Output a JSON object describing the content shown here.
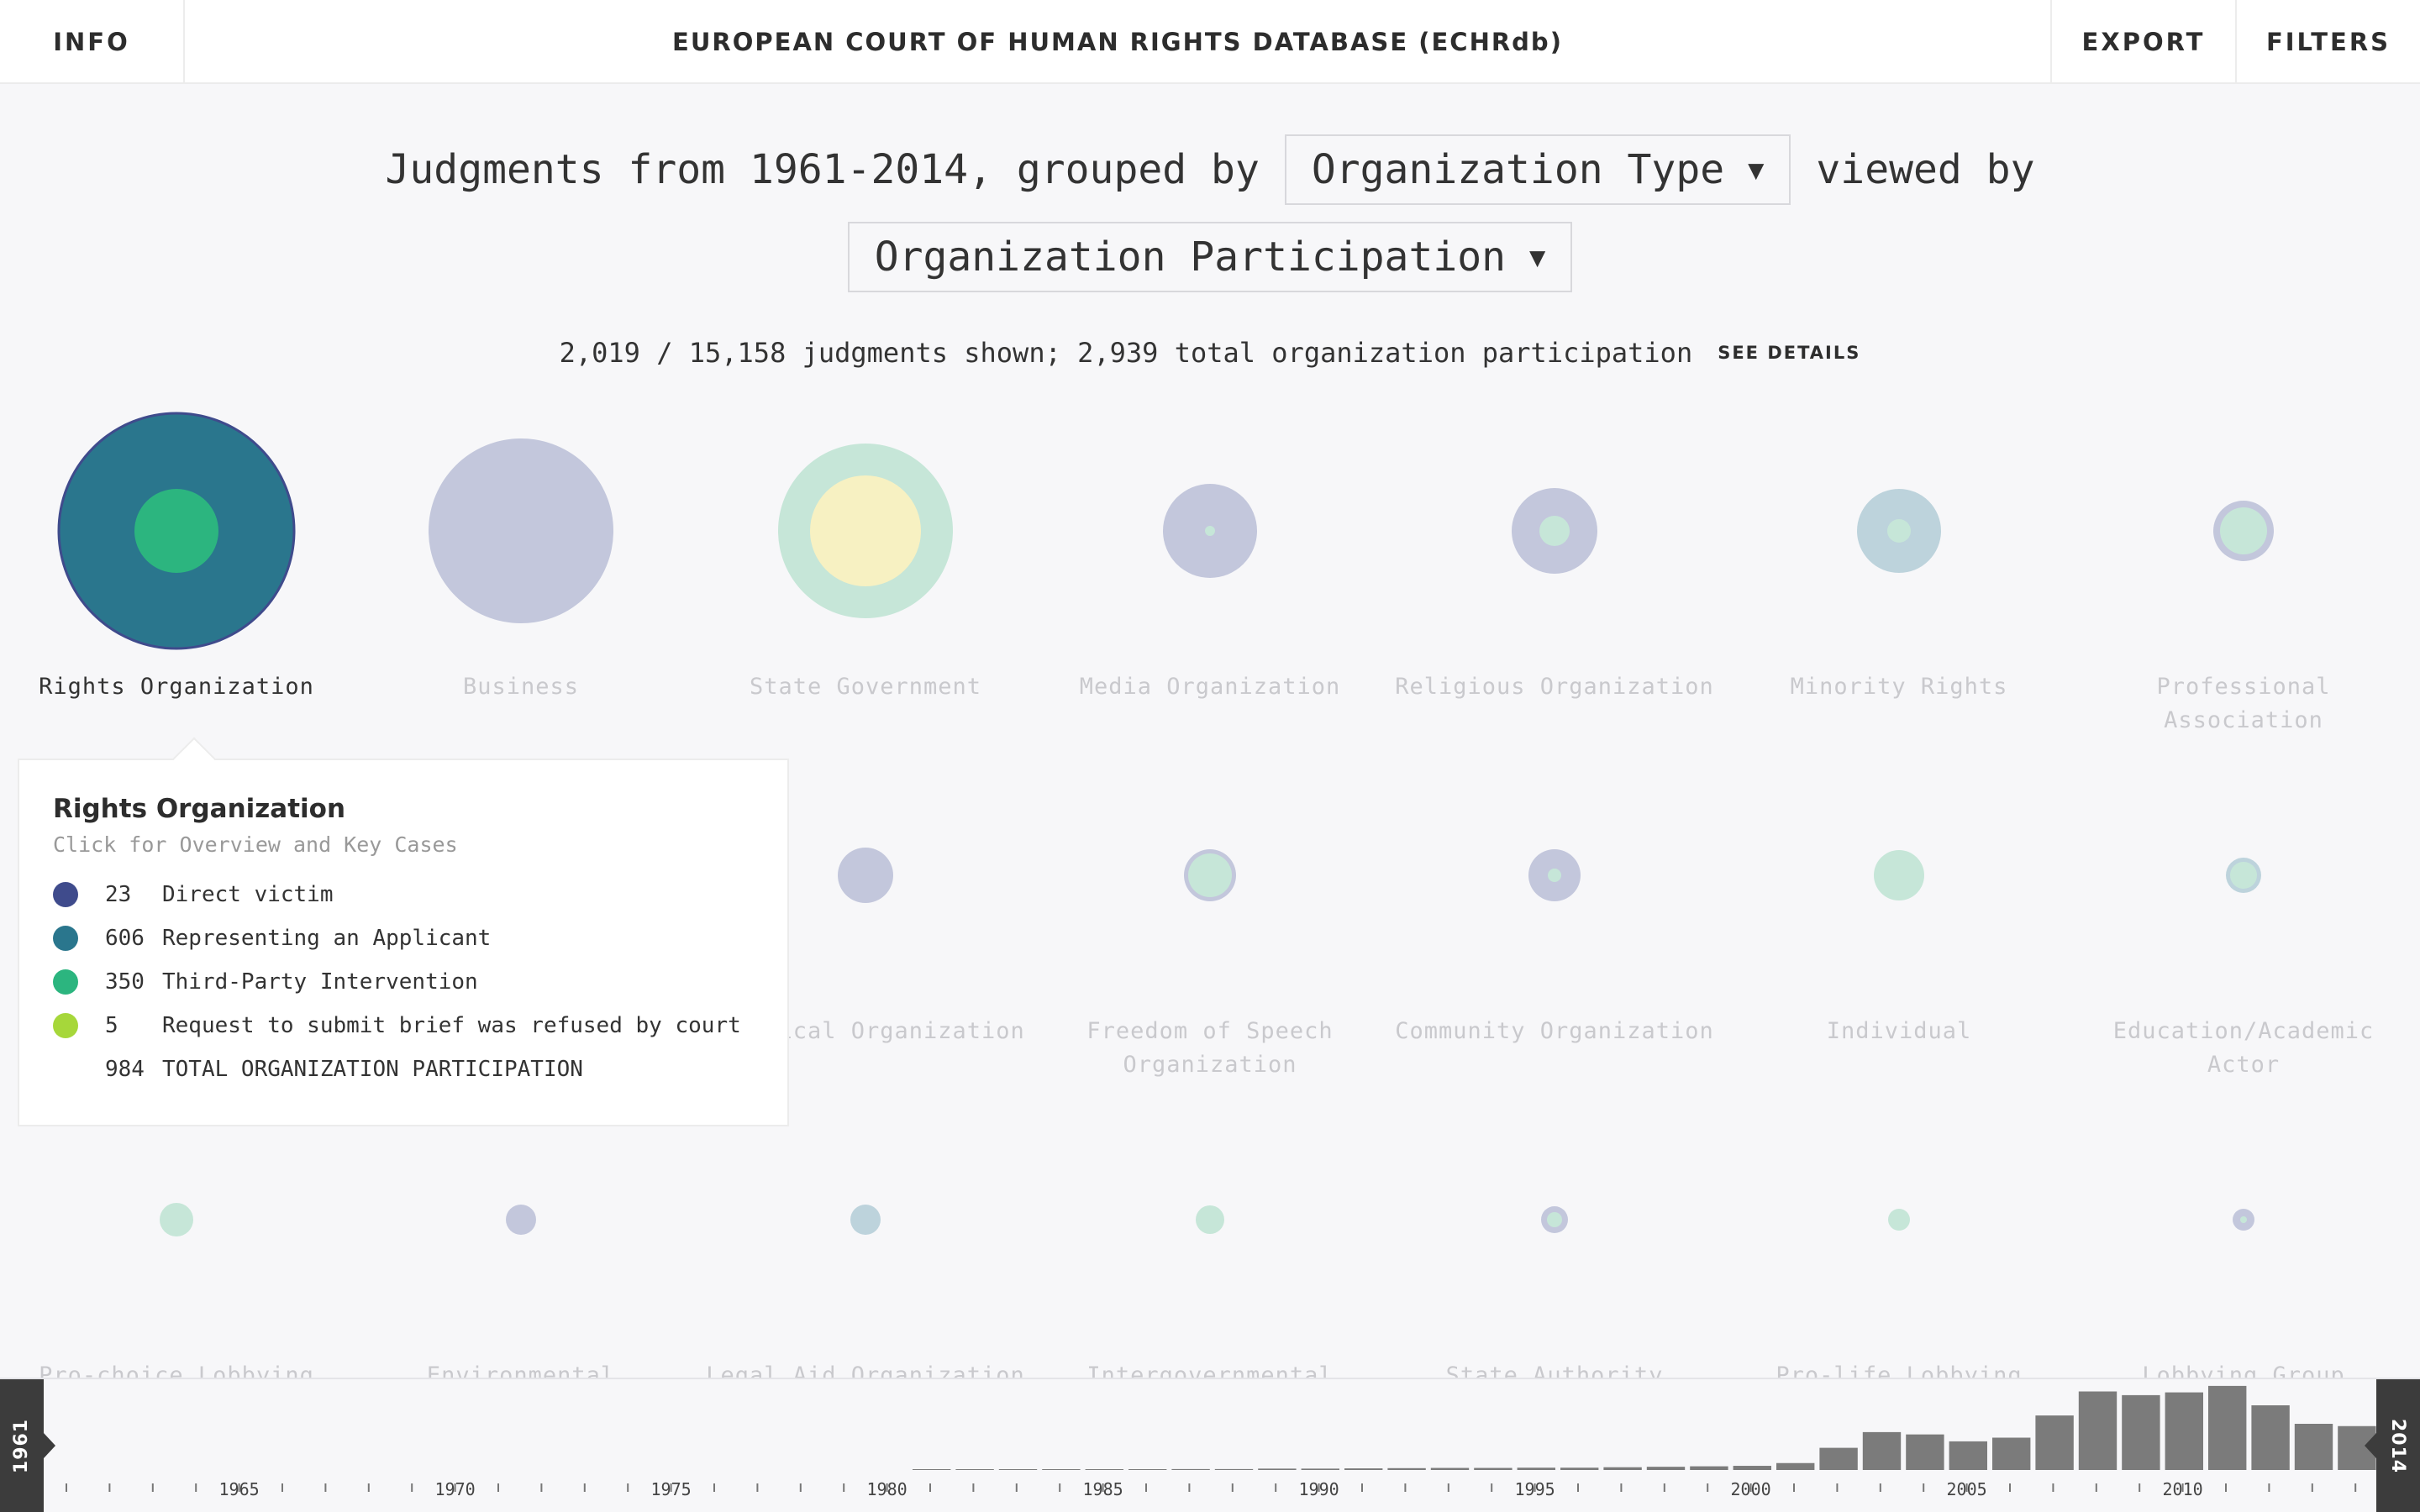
{
  "header": {
    "info_label": "INFO",
    "title": "EUROPEAN COURT OF HUMAN RIGHTS DATABASE (ECHRdb)",
    "export_label": "EXPORT",
    "filters_label": "FILTERS"
  },
  "query": {
    "prefix": "Judgments from 1961-2014, grouped by",
    "group_by": "Organization Type",
    "middle": "viewed by",
    "view_by": "Organization Participation",
    "caret": "▼"
  },
  "summary": {
    "text": "2,019 / 15,158 judgments shown; 2,939 total organization participation",
    "see_details": "SEE DETAILS"
  },
  "colors": {
    "direct_victim": "#3f4b8c",
    "representing": "#2a768d",
    "third_party": "#2cb57f",
    "refused": "#a6d73a",
    "faded_blue": "#c3c7dc",
    "faded_teal": "#bdd3dc",
    "faded_green": "#c6e6d8",
    "faded_yellow": "#f7f1c2"
  },
  "groups": [
    {
      "label": "Rights Organization",
      "active": true,
      "rings": [
        {
          "r": 140,
          "fill": "#2a768d",
          "stroke": "#3f4b8c"
        },
        {
          "r": 50,
          "fill": "#2cb57f"
        }
      ]
    },
    {
      "label": "Business",
      "rings": [
        {
          "r": 110,
          "fill": "#c3c7dc"
        }
      ]
    },
    {
      "label": "State Government",
      "rings": [
        {
          "r": 104,
          "fill": "#c6e6d8"
        },
        {
          "r": 66,
          "fill": "#f7f1c2"
        }
      ]
    },
    {
      "label": "Media Organization",
      "rings": [
        {
          "r": 56,
          "fill": "#c3c7dc"
        },
        {
          "r": 6,
          "fill": "#c6e6d8"
        }
      ]
    },
    {
      "label": "Religious Organization",
      "rings": [
        {
          "r": 51,
          "fill": "#c3c7dc"
        },
        {
          "r": 18,
          "fill": "#c6e6d8"
        }
      ]
    },
    {
      "label": "Minority Rights",
      "rings": [
        {
          "r": 50,
          "fill": "#bdd3dc"
        },
        {
          "r": 14,
          "fill": "#c6e6d8"
        }
      ]
    },
    {
      "label": "Professional Association",
      "rings": [
        {
          "r": 36,
          "fill": "#c3c7dc"
        },
        {
          "r": 28,
          "fill": "#c6e6d8"
        }
      ]
    },
    {
      "label": "",
      "rings": []
    },
    {
      "label": "",
      "rings": []
    },
    {
      "label": "Political Organization",
      "rings": [
        {
          "r": 33,
          "fill": "#c3c7dc"
        }
      ]
    },
    {
      "label": "Freedom of Speech Organization",
      "rings": [
        {
          "r": 31,
          "fill": "#c3c7dc"
        },
        {
          "r": 26,
          "fill": "#c6e6d8"
        }
      ]
    },
    {
      "label": "Community Organization",
      "rings": [
        {
          "r": 31,
          "fill": "#c3c7dc"
        },
        {
          "r": 8,
          "fill": "#c6e6d8"
        }
      ]
    },
    {
      "label": "Individual",
      "rings": [
        {
          "r": 30,
          "fill": "#c6e6d8"
        }
      ]
    },
    {
      "label": "Education/Academic Actor",
      "rings": [
        {
          "r": 21,
          "fill": "#bdd3dc"
        },
        {
          "r": 16,
          "fill": "#c6e6d8"
        }
      ]
    },
    {
      "label": "Pro-choice Lobbying",
      "rings": [
        {
          "r": 20,
          "fill": "#c6e6d8"
        },
        {
          "r": 17,
          "fill": "#c6e6d8"
        }
      ]
    },
    {
      "label": "Environmental",
      "rings": [
        {
          "r": 18,
          "fill": "#c3c7dc"
        }
      ]
    },
    {
      "label": "Legal Aid Organization",
      "rings": [
        {
          "r": 18,
          "fill": "#bdd3dc"
        }
      ]
    },
    {
      "label": "Intergovernmental",
      "rings": [
        {
          "r": 17,
          "fill": "#c6e6d8"
        }
      ]
    },
    {
      "label": "State Authority",
      "rings": [
        {
          "r": 16,
          "fill": "#c3c7dc"
        },
        {
          "r": 9,
          "fill": "#c6e6d8"
        }
      ]
    },
    {
      "label": "Pro-life Lobbying",
      "rings": [
        {
          "r": 13,
          "fill": "#c6e6d8"
        }
      ]
    },
    {
      "label": "Lobbying Group",
      "rings": [
        {
          "r": 13,
          "fill": "#c3c7dc"
        },
        {
          "r": 4,
          "fill": "#c6e6d8"
        }
      ]
    }
  ],
  "tooltip": {
    "title": "Rights Organization",
    "subtitle": "Click for Overview and Key Cases",
    "rows": [
      {
        "count": "23",
        "label": "Direct victim",
        "color": "#3f4b8c"
      },
      {
        "count": "606",
        "label": "Representing an Applicant",
        "color": "#2a768d"
      },
      {
        "count": "350",
        "label": "Third-Party Intervention",
        "color": "#2cb57f"
      },
      {
        "count": "5",
        "label": "Request to submit brief was refused by court",
        "color": "#a6d73a"
      }
    ],
    "total_count": "984",
    "total_label": "TOTAL ORGANIZATION PARTICIPATION"
  },
  "timeline": {
    "start_label": "1961",
    "end_label": "2014",
    "year_labels": [
      "1965",
      "1970",
      "1975",
      "1980",
      "1985",
      "1990",
      "1995",
      "2000",
      "2005",
      "2010"
    ]
  },
  "chart_data": {
    "type": "bar",
    "categories": [
      "1961",
      "1962",
      "1963",
      "1964",
      "1965",
      "1966",
      "1967",
      "1968",
      "1969",
      "1970",
      "1971",
      "1972",
      "1973",
      "1974",
      "1975",
      "1976",
      "1977",
      "1978",
      "1979",
      "1980",
      "1981",
      "1982",
      "1983",
      "1984",
      "1985",
      "1986",
      "1987",
      "1988",
      "1989",
      "1990",
      "1991",
      "1992",
      "1993",
      "1994",
      "1995",
      "1996",
      "1997",
      "1998",
      "1999",
      "2000",
      "2001",
      "2002",
      "2003",
      "2004",
      "2005",
      "2006",
      "2007",
      "2008",
      "2009",
      "2010",
      "2011",
      "2012",
      "2013",
      "2014"
    ],
    "values": [
      0,
      0,
      0,
      0,
      0,
      0,
      0,
      0,
      0,
      0,
      0,
      0,
      0,
      0,
      0,
      0,
      0,
      0,
      0,
      0,
      0.5,
      0.5,
      1,
      1,
      1.5,
      1.5,
      2,
      2,
      3,
      3,
      3.5,
      4,
      4.5,
      4.5,
      5,
      5,
      6,
      7,
      8,
      9,
      15,
      48,
      82,
      77,
      62,
      70,
      118,
      170,
      162,
      168,
      182,
      140,
      100,
      95,
      80
    ]
  }
}
